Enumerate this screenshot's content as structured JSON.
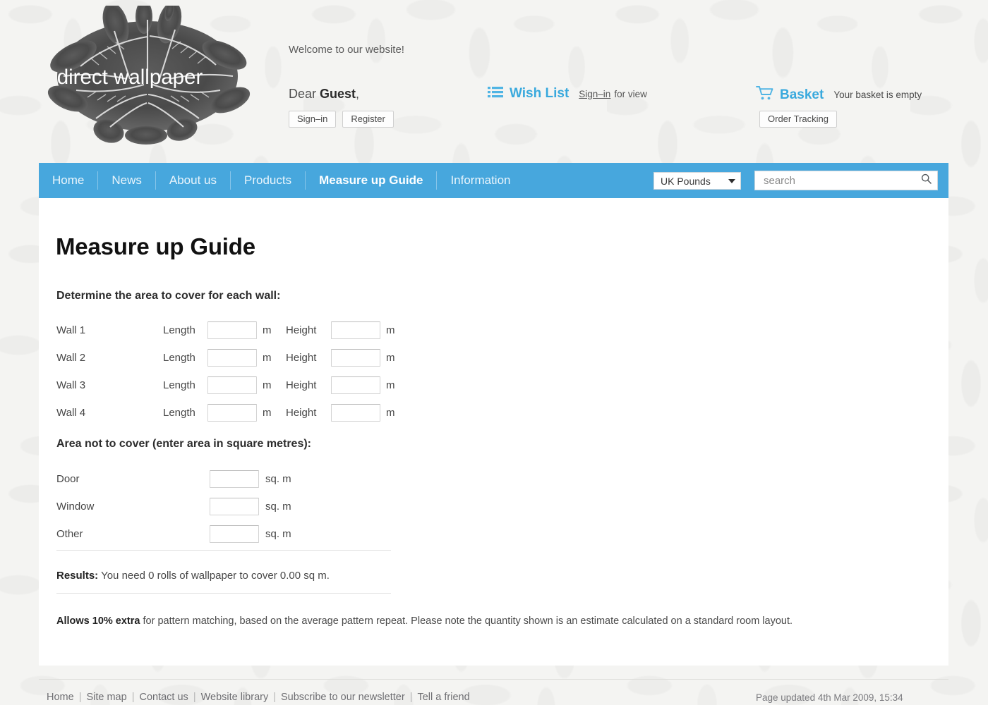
{
  "header": {
    "logo_text": "direct wallpaper",
    "welcome": "Welcome to our website!",
    "dear_prefix": "Dear ",
    "dear_name": "Guest",
    "dear_suffix": ",",
    "signin_button": "Sign–in",
    "register_button": "Register",
    "wish_list_label": "Wish List",
    "wish_list_signin": "Sign–in",
    "wish_list_forview": "for view",
    "basket_label": "Basket",
    "basket_status": "Your basket is empty",
    "order_tracking_button": "Order Tracking"
  },
  "nav": {
    "items": [
      {
        "label": "Home",
        "active": false
      },
      {
        "label": "News",
        "active": false
      },
      {
        "label": "About us",
        "active": false
      },
      {
        "label": "Products",
        "active": false
      },
      {
        "label": "Measure up Guide",
        "active": true
      },
      {
        "label": "Information",
        "active": false
      }
    ],
    "currency_selected": "UK Pounds",
    "currency_options": [
      "UK Pounds"
    ],
    "search_placeholder": "search",
    "search_value": ""
  },
  "main": {
    "title": "Measure up Guide",
    "walls_heading": "Determine the area to cover for each wall:",
    "length_label": "Length",
    "height_label": "Height",
    "unit_m": "m",
    "walls": [
      {
        "name": "Wall 1",
        "length": "",
        "height": ""
      },
      {
        "name": "Wall 2",
        "length": "",
        "height": ""
      },
      {
        "name": "Wall 3",
        "length": "",
        "height": ""
      },
      {
        "name": "Wall 4",
        "length": "",
        "height": ""
      }
    ],
    "areas_heading": "Area not to cover (enter area in square metres):",
    "unit_sqm": "sq. m",
    "areas": [
      {
        "name": "Door",
        "value": ""
      },
      {
        "name": "Window",
        "value": ""
      },
      {
        "name": "Other",
        "value": ""
      }
    ],
    "results_label": "Results:",
    "results_text": " You need 0 rolls of wallpaper to cover 0.00 sq m.",
    "note_bold": "Allows 10% extra",
    "note_text": " for pattern matching, based on the average pattern repeat. Please note the quantity shown is an estimate calculated on a standard room layout."
  },
  "footer": {
    "links": [
      "Home",
      "Site map",
      "Contact us",
      "Website library",
      "Subscribe to our newsletter",
      "Tell a friend"
    ],
    "updated": "Page updated 4th Mar 2009, 15:34"
  },
  "colors": {
    "nav_blue": "#47a7dd",
    "accent_blue": "#39a9dd",
    "page_bg": "#f4f4f2",
    "content_bg": "#ffffff"
  }
}
